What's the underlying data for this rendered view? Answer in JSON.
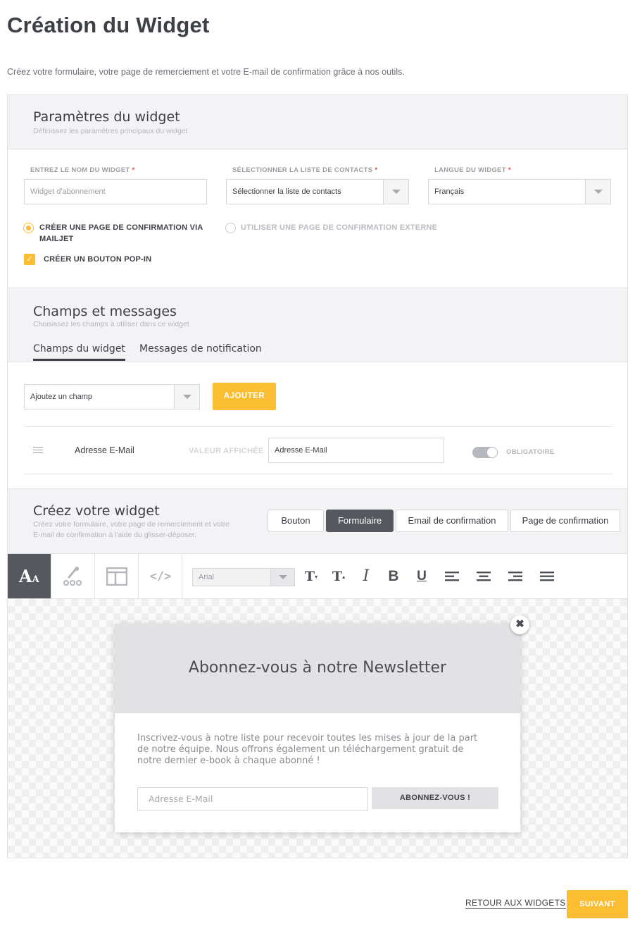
{
  "page": {
    "title": "Création du Widget",
    "subtitle": "Créez votre formulaire, votre page de remerciement et votre E-mail de confirmation grâce à nos outils."
  },
  "settings": {
    "title": "Paramètres du widget",
    "subtitle": "Définissez les paramètres principaux du widget",
    "name_label": "ENTREZ LE NOM DU WIDGET",
    "name_placeholder": "Widget d'abonnement",
    "list_label": "SÉLECTIONNER LA LISTE DE CONTACTS",
    "list_value": "Sélectionner la liste de contacts",
    "lang_label": "LANGUE DU WIDGET",
    "lang_value": "Français",
    "required_mark": "*",
    "radio_mailjet_line1": "CRÉER UNE PAGE DE CONFIRMATION VIA",
    "radio_mailjet_line2": "MAILJET",
    "radio_external": "UTILISER UNE PAGE DE CONFIRMATION EXTERNE",
    "popin_label": "CRÉER UN BOUTON POP-IN",
    "popin_checked": true
  },
  "fields": {
    "title": "Champs et messages",
    "subtitle": "Choisissez les champs à utiliser dans ce widget",
    "tabs": [
      {
        "label": "Champs du widget",
        "active": true
      },
      {
        "label": "Messages de notification",
        "active": false
      }
    ],
    "add_select": "Ajoutez un champ",
    "add_button": "AJOUTER",
    "row": {
      "field_name": "Adresse E-Mail",
      "value_label": "VALEUR AFFICHÉE",
      "value": "Adresse E-Mail",
      "required_label": "OBLIGATOIRE",
      "required_on": true
    }
  },
  "builder": {
    "title": "Créez votre widget",
    "subtitle_line1": "Créez votre formulaire, votre page de remerciement et votre",
    "subtitle_line2": "E-mail de confirmation à l'aide du glisser-déposer.",
    "modes": [
      {
        "label": "Bouton",
        "active": false
      },
      {
        "label": "Formulaire",
        "active": true
      },
      {
        "label": "Email de confirmation",
        "active": false
      },
      {
        "label": "Page de confirmation",
        "active": false
      }
    ],
    "toolbar": {
      "font": "Arial",
      "tools": [
        "text-style-icon",
        "dropper-icon",
        "layout-icon",
        "code-icon"
      ],
      "format_icons": [
        "font-size-down-icon",
        "font-size-up-icon",
        "italic-icon",
        "bold-icon",
        "underline-icon",
        "align-left-icon",
        "align-center-icon",
        "align-right-icon",
        "justify-icon"
      ]
    }
  },
  "preview": {
    "title": "Abonnez-vous à notre Newsletter",
    "text_line1": "Inscrivez-vous à notre liste pour recevoir toutes les mises à jour de la part",
    "text_line2": "de notre équipe. Nous offrons également un téléchargement gratuit de",
    "text_line3": "notre dernier e-book à chaque abonné !",
    "email_placeholder": "Adresse E-Mail",
    "subscribe": "ABONNEZ-VOUS !",
    "close": "✖"
  },
  "footer": {
    "back": "RETOUR AUX WIDGETS",
    "next": "SUIVANT"
  },
  "colors": {
    "accent": "#fbbe32",
    "dark": "#55585e",
    "required": "#e0453b"
  }
}
